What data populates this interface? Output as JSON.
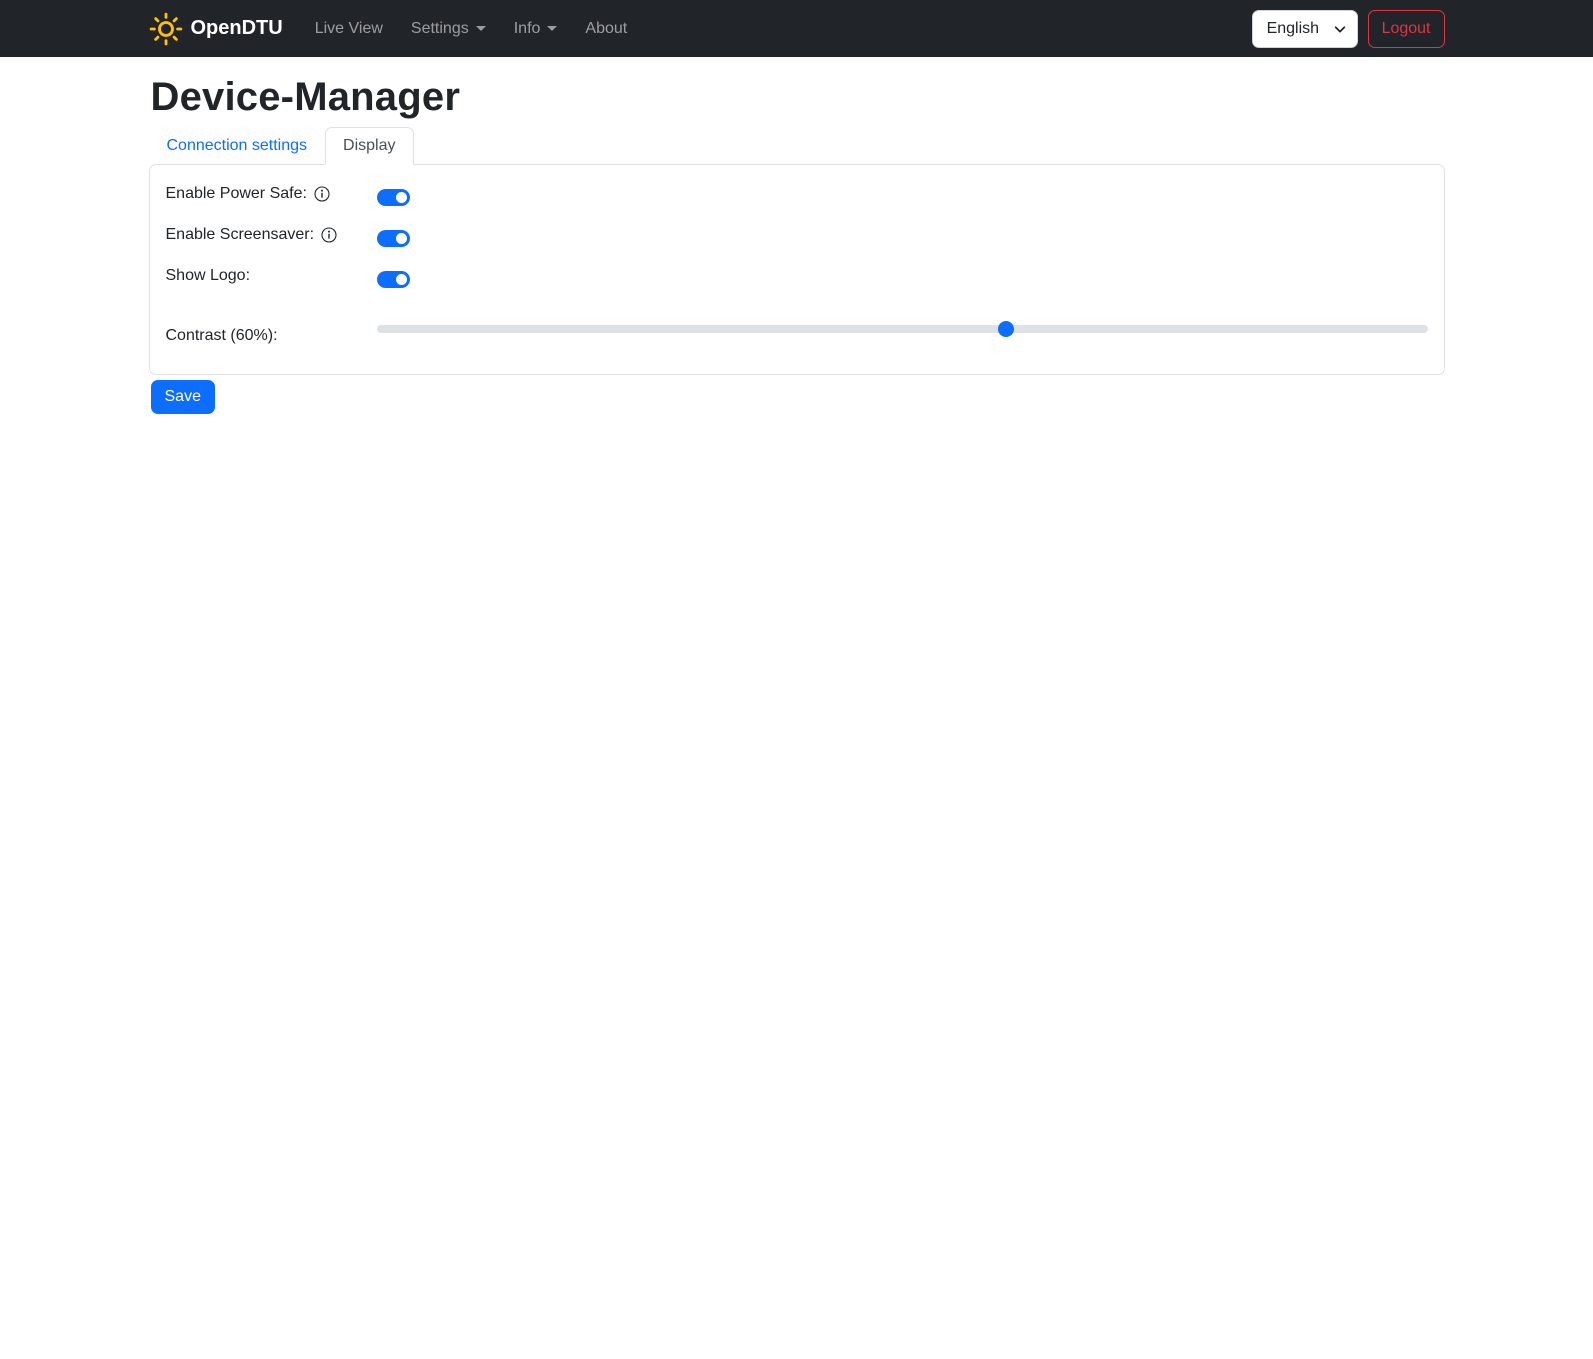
{
  "navbar": {
    "brand": "OpenDTU",
    "links": [
      {
        "label": "Live View",
        "has_dropdown": false
      },
      {
        "label": "Settings",
        "has_dropdown": true
      },
      {
        "label": "Info",
        "has_dropdown": true
      },
      {
        "label": "About",
        "has_dropdown": false
      }
    ],
    "language_selector": {
      "selected": "English"
    },
    "logout_label": "Logout"
  },
  "page": {
    "title": "Device-Manager"
  },
  "tabs": [
    {
      "label": "Connection settings",
      "active": false
    },
    {
      "label": "Display",
      "active": true
    }
  ],
  "form": {
    "rows": [
      {
        "label": "Enable Power Safe:",
        "control": "toggle",
        "checked": true,
        "has_info": true
      },
      {
        "label": "Enable Screensaver:",
        "control": "toggle",
        "checked": true,
        "has_info": true
      },
      {
        "label": "Show Logo:",
        "control": "toggle",
        "checked": true,
        "has_info": false
      },
      {
        "label": "Contrast (60%):",
        "control": "slider",
        "value": 60,
        "min": 0,
        "max": 100
      }
    ],
    "save_label": "Save"
  },
  "colors": {
    "accent": "#0d6efd",
    "navbar_bg": "#212529",
    "danger": "#dc3545",
    "sun": "#ffc107",
    "border": "#dee2e6"
  }
}
